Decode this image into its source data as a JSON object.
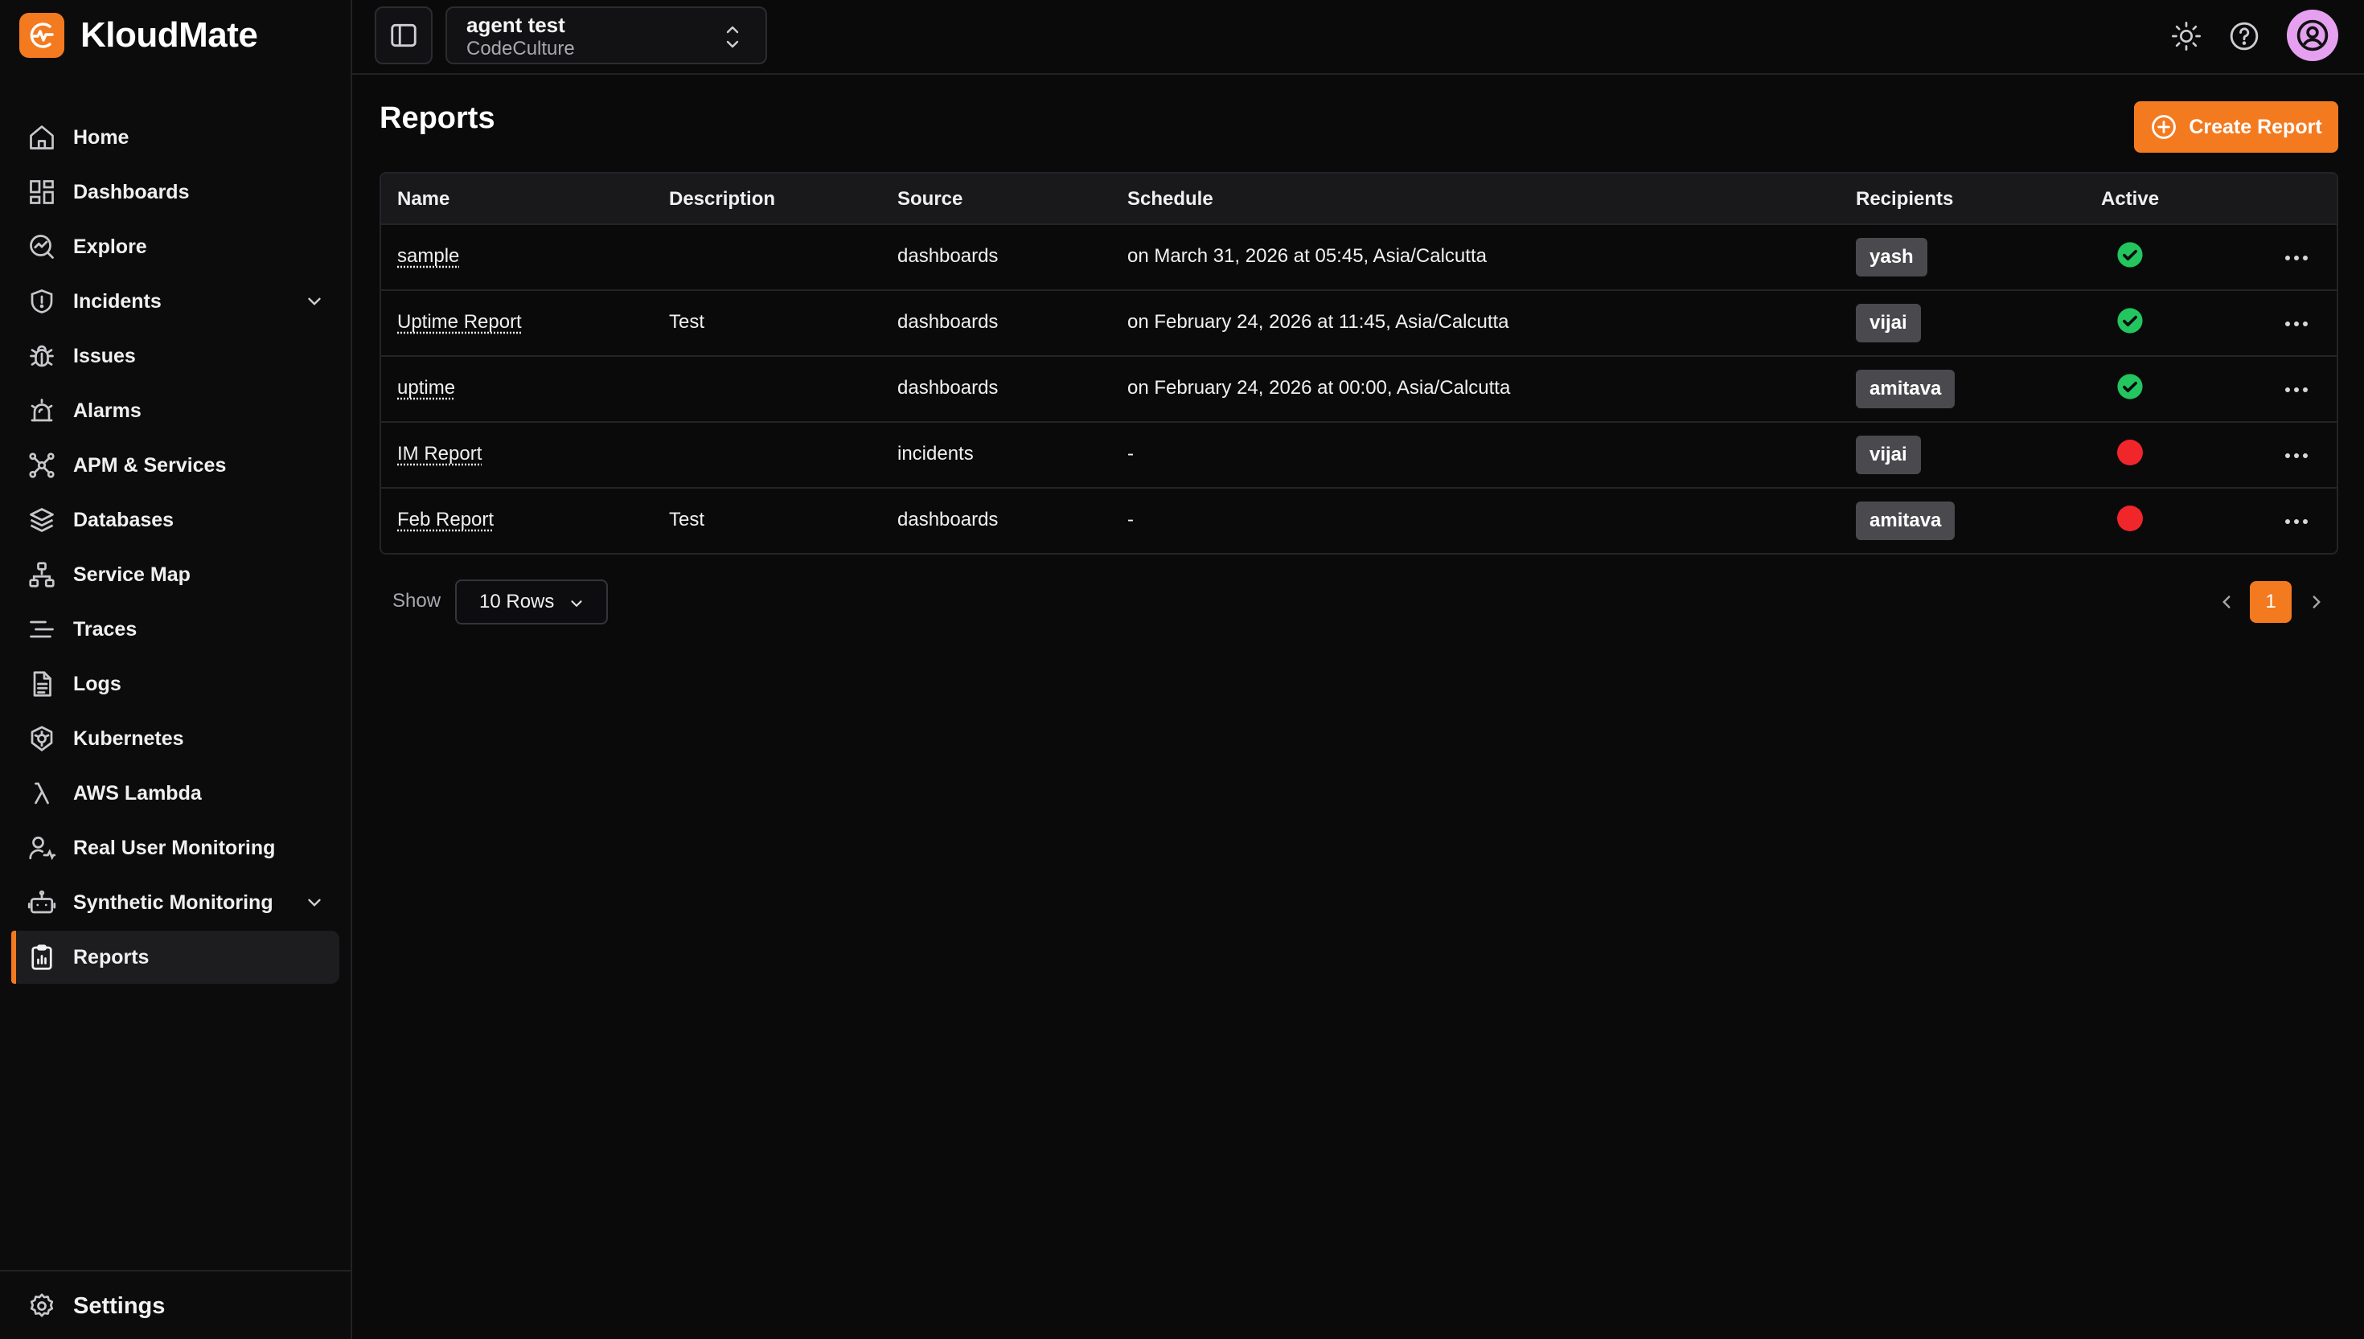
{
  "app": {
    "name": "KloudMate"
  },
  "colors": {
    "accent": "#f47a20",
    "active_green": "#22c55e",
    "inactive_red": "#f0262a"
  },
  "workspace": {
    "name": "agent test",
    "org": "CodeCulture"
  },
  "sidebar": {
    "items": [
      {
        "label": "Home",
        "icon": "home-icon"
      },
      {
        "label": "Dashboards",
        "icon": "dashboards-icon"
      },
      {
        "label": "Explore",
        "icon": "explore-icon"
      },
      {
        "label": "Incidents",
        "icon": "shield-icon",
        "expandable": true
      },
      {
        "label": "Issues",
        "icon": "bug-icon"
      },
      {
        "label": "Alarms",
        "icon": "alarm-icon"
      },
      {
        "label": "APM & Services",
        "icon": "apm-icon"
      },
      {
        "label": "Databases",
        "icon": "database-icon"
      },
      {
        "label": "Service Map",
        "icon": "service-map-icon"
      },
      {
        "label": "Traces",
        "icon": "traces-icon"
      },
      {
        "label": "Logs",
        "icon": "logs-icon"
      },
      {
        "label": "Kubernetes",
        "icon": "kubernetes-icon"
      },
      {
        "label": "AWS Lambda",
        "icon": "lambda-icon"
      },
      {
        "label": "Real User Monitoring",
        "icon": "user-monitoring-icon"
      },
      {
        "label": "Synthetic Monitoring",
        "icon": "robot-icon",
        "expandable": true
      },
      {
        "label": "Reports",
        "icon": "reports-icon",
        "active": true
      }
    ],
    "settings_label": "Settings"
  },
  "main": {
    "title": "Reports",
    "create_label": "Create Report",
    "columns": [
      "Name",
      "Description",
      "Source",
      "Schedule",
      "Recipients",
      "Active"
    ],
    "rows": [
      {
        "name": "sample",
        "description": "",
        "source": "dashboards",
        "schedule": "on March 31, 2026 at 05:45, Asia/Calcutta",
        "recipient": "yash",
        "active": true
      },
      {
        "name": "Uptime Report",
        "description": "Test",
        "source": "dashboards",
        "schedule": "on February 24, 2026 at 11:45, Asia/Calcutta",
        "recipient": "vijai",
        "active": true
      },
      {
        "name": "uptime",
        "description": "",
        "source": "dashboards",
        "schedule": "on February 24, 2026 at 00:00, Asia/Calcutta",
        "recipient": "amitava",
        "active": true
      },
      {
        "name": "IM Report",
        "description": "",
        "source": "incidents",
        "schedule": "-",
        "recipient": "vijai",
        "active": false
      },
      {
        "name": "Feb Report",
        "description": "Test",
        "source": "dashboards",
        "schedule": "-",
        "recipient": "amitava",
        "active": false
      }
    ]
  },
  "pagination": {
    "show_label": "Show",
    "rows_label": "10 Rows",
    "current_page": "1"
  }
}
